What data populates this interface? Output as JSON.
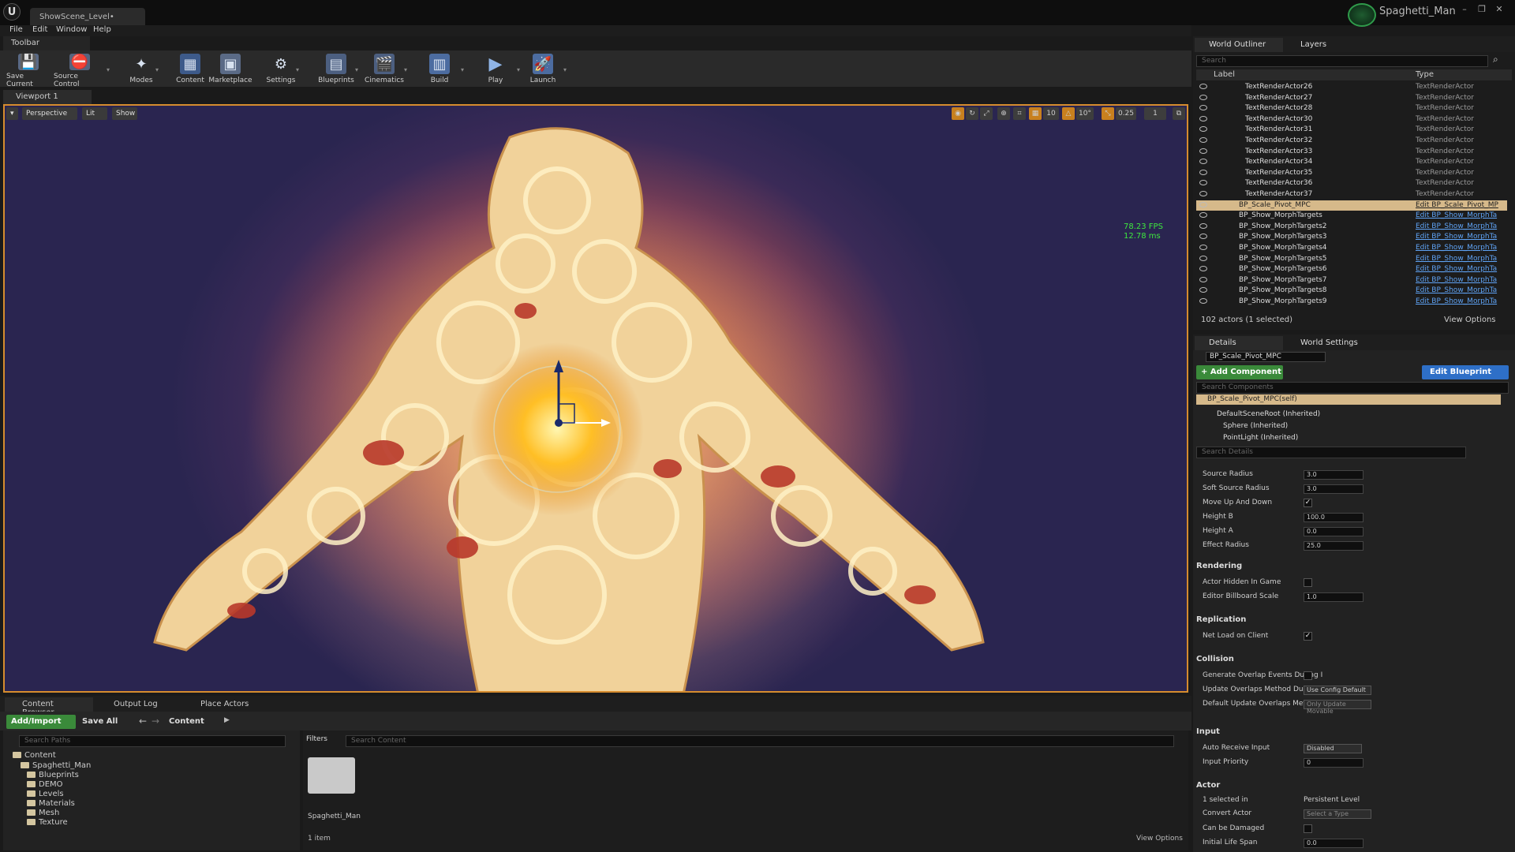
{
  "window": {
    "doc_tab": "ShowScene_Level•",
    "user": "Spaghetti_Man",
    "min": "–",
    "max": "❐",
    "close": "✕",
    "logo": "U"
  },
  "menu": [
    "File",
    "Edit",
    "Window",
    "Help"
  ],
  "toolbar": {
    "tab": "Toolbar",
    "buttons": [
      "Save Current",
      "Source Control",
      "Modes",
      "Content",
      "Marketplace",
      "Settings",
      "Blueprints",
      "Cinematics",
      "Build",
      "Play",
      "Launch"
    ]
  },
  "viewport": {
    "tab": "Viewport 1",
    "perspective": "Perspective",
    "lit": "Lit",
    "show": "Show",
    "grid_snap": "10",
    "rot_snap": "10°",
    "scale_snap": "0.25",
    "cam_speed": "1",
    "fps": "78.23 FPS",
    "ms": "12.78 ms"
  },
  "content_browser": {
    "tabs": [
      "Content Browser",
      "Output Log",
      "Place Actors"
    ],
    "add_import": "Add/Import",
    "save_all": "Save All",
    "path": "Content",
    "search_paths": "Search Paths",
    "filters": "Filters",
    "search_content": "Search Content",
    "tree": {
      "root": "Content",
      "project": "Spaghetti_Man",
      "children": [
        "Blueprints",
        "DEMO",
        "Levels",
        "Materials",
        "Mesh",
        "Texture"
      ]
    },
    "asset": "Spaghetti_Man",
    "count": "1 item",
    "view_options": "View Options"
  },
  "outliner": {
    "tabs": [
      "World Outliner",
      "Layers"
    ],
    "search": "Search",
    "col_label": "Label",
    "col_type": "Type",
    "rows": [
      {
        "label": "TextRenderActor26",
        "type": "TextRenderActor"
      },
      {
        "label": "TextRenderActor27",
        "type": "TextRenderActor"
      },
      {
        "label": "TextRenderActor28",
        "type": "TextRenderActor"
      },
      {
        "label": "TextRenderActor30",
        "type": "TextRenderActor"
      },
      {
        "label": "TextRenderActor31",
        "type": "TextRenderActor"
      },
      {
        "label": "TextRenderActor32",
        "type": "TextRenderActor"
      },
      {
        "label": "TextRenderActor33",
        "type": "TextRenderActor"
      },
      {
        "label": "TextRenderActor34",
        "type": "TextRenderActor"
      },
      {
        "label": "TextRenderActor35",
        "type": "TextRenderActor"
      },
      {
        "label": "TextRenderActor36",
        "type": "TextRenderActor"
      },
      {
        "label": "TextRenderActor37",
        "type": "TextRenderActor"
      },
      {
        "label": "BP_Scale_Pivot_MPC",
        "type": "Edit BP_Scale_Pivot_MP"
      },
      {
        "label": "BP_Show_MorphTargets",
        "type": "Edit BP_Show_MorphTa"
      },
      {
        "label": "BP_Show_MorphTargets2",
        "type": "Edit BP_Show_MorphTa"
      },
      {
        "label": "BP_Show_MorphTargets3",
        "type": "Edit BP_Show_MorphTa"
      },
      {
        "label": "BP_Show_MorphTargets4",
        "type": "Edit BP_Show_MorphTa"
      },
      {
        "label": "BP_Show_MorphTargets5",
        "type": "Edit BP_Show_MorphTa"
      },
      {
        "label": "BP_Show_MorphTargets6",
        "type": "Edit BP_Show_MorphTa"
      },
      {
        "label": "BP_Show_MorphTargets7",
        "type": "Edit BP_Show_MorphTa"
      },
      {
        "label": "BP_Show_MorphTargets8",
        "type": "Edit BP_Show_MorphTa"
      },
      {
        "label": "BP_Show_MorphTargets9",
        "type": "Edit BP_Show_MorphTa"
      }
    ],
    "footer": "102 actors (1 selected)",
    "view_options": "View Options"
  },
  "details": {
    "tabs": [
      "Details",
      "World Settings"
    ],
    "actor_name": "BP_Scale_Pivot_MPC",
    "add_component": "+ Add Component",
    "edit_blueprint": "Edit Blueprint",
    "search_components": "Search Components",
    "components": [
      "BP_Scale_Pivot_MPC(self)",
      "DefaultSceneRoot (Inherited)",
      "Sphere (Inherited)",
      "PointLight (Inherited)"
    ],
    "search_details": "Search Details",
    "props_top": [
      {
        "name": "Source Radius",
        "value": "3.0"
      },
      {
        "name": "Soft Source Radius",
        "value": "3.0"
      },
      {
        "name": "Move Up And Down",
        "value": "✓"
      },
      {
        "name": "Height B",
        "value": "100.0"
      },
      {
        "name": "Height A",
        "value": "0.0"
      },
      {
        "name": "Effect Radius",
        "value": "25.0"
      }
    ],
    "rendering": {
      "title": "Rendering",
      "hidden": "Actor Hidden In Game",
      "billboard": "Editor Billboard Scale",
      "billboard_val": "1.0"
    },
    "replication": {
      "title": "Replication",
      "net_load": "Net Load on Client",
      "net_load_val": "✓"
    },
    "collision": {
      "title": "Collision",
      "gen_overlap": "Generate Overlap Events During I",
      "update_overlap": "Update Overlaps Method During I",
      "update_val": "Use Config Default",
      "default_overlap": "Default Update Overlaps Method",
      "default_val": "Only Update Movable"
    },
    "input": {
      "title": "Input",
      "auto_receive": "Auto Receive Input",
      "auto_val": "Disabled",
      "priority": "Input Priority",
      "priority_val": "0"
    },
    "actor": {
      "title": "Actor",
      "selected_in": "1 selected in",
      "level": "Persistent Level",
      "convert": "Convert Actor",
      "convert_val": "Select a Type",
      "damaged": "Can be Damaged",
      "life": "Initial Life Span",
      "life_val": "0.0"
    }
  }
}
